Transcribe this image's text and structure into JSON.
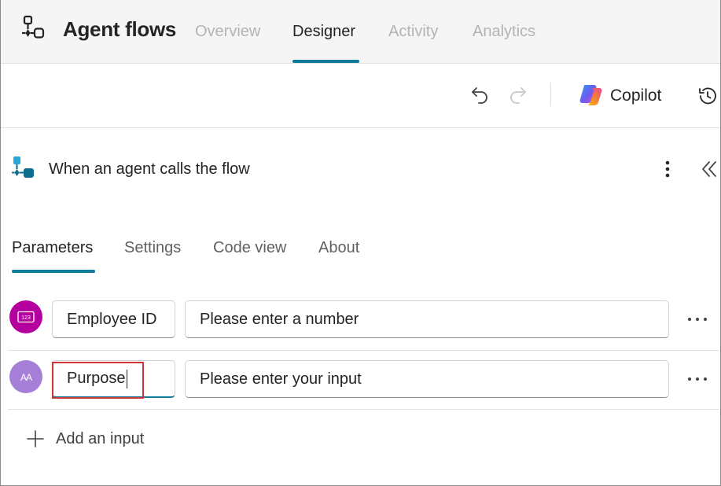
{
  "header": {
    "app_title": "Agent flows",
    "tabs": [
      {
        "label": "Overview",
        "active": false
      },
      {
        "label": "Designer",
        "active": true
      },
      {
        "label": "Activity",
        "active": false
      },
      {
        "label": "Analytics",
        "active": false
      }
    ]
  },
  "toolbar": {
    "undo_icon": "undo-icon",
    "redo_icon": "redo-icon",
    "copilot_label": "Copilot",
    "history_icon": "history-icon"
  },
  "trigger": {
    "title": "When an agent calls the flow",
    "icon": "agent-flow-trigger-icon"
  },
  "subtabs": [
    {
      "label": "Parameters",
      "active": true
    },
    {
      "label": "Settings",
      "active": false
    },
    {
      "label": "Code view",
      "active": false
    },
    {
      "label": "About",
      "active": false
    }
  ],
  "parameters": [
    {
      "type_icon": "number-type-icon",
      "type_badge": "123",
      "color": "#b4009e",
      "name": "Employee ID",
      "description": "Please enter a number"
    },
    {
      "type_icon": "text-type-icon",
      "type_badge": "AA",
      "color": "#a680d8",
      "name": "Purpose",
      "description": "Please enter your input"
    }
  ],
  "add_input_label": "Add an input",
  "colors": {
    "accent": "#0f7b9b",
    "highlight": "#d13438"
  }
}
